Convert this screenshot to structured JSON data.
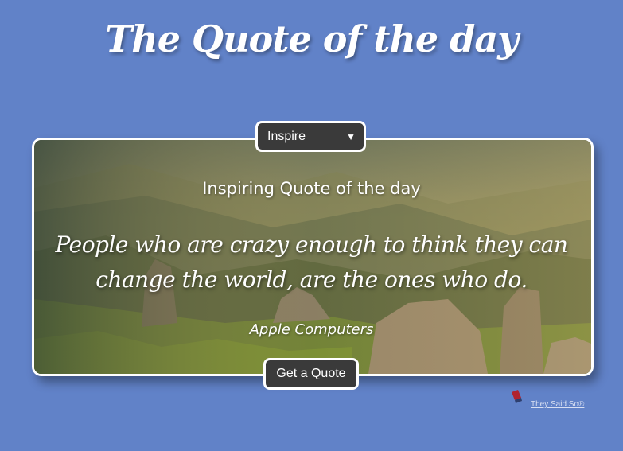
{
  "page": {
    "title": "The Quote of the day",
    "background_color": "#6182c8"
  },
  "selector": {
    "selected": "Inspire",
    "chevron_icon": "chevron-down-icon"
  },
  "quote": {
    "heading": "Inspiring Quote of the day",
    "text": "People who are crazy enough to think they can change the world, are the ones who do.",
    "author": "Apple Computers",
    "background_image": "mountain-landscape"
  },
  "actions": {
    "get_quote_label": "Get a Quote"
  },
  "attribution": {
    "link_text": "They Said So®",
    "logo_icon": "they-said-so-logo"
  },
  "colors": {
    "button_bg": "#3a3a3a",
    "button_border": "#ffffff",
    "text": "#ffffff"
  }
}
